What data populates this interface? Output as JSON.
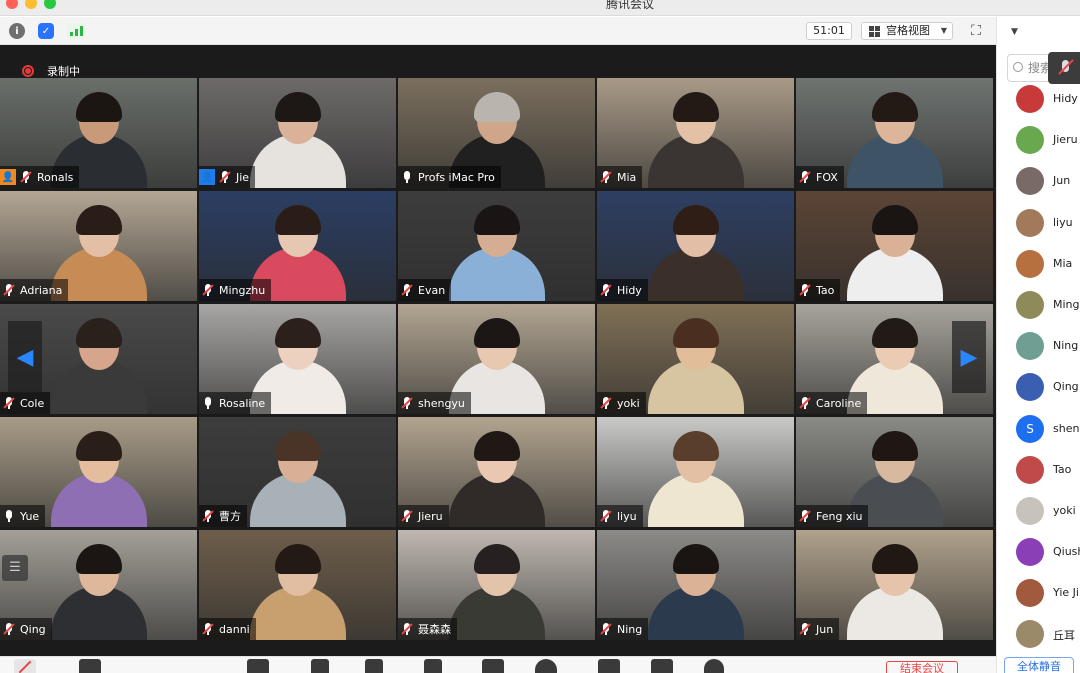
{
  "window": {
    "title": "腾讯会议"
  },
  "toolbar": {
    "timer": "51:01",
    "view_label": "宫格视图"
  },
  "recording": {
    "label": "录制中"
  },
  "tiles": [
    {
      "name": "Ronals",
      "muted": true,
      "badge": "orange",
      "bg": "#6a6f6a",
      "skin": "#c99a7a",
      "hair": "#1c1612",
      "shirt": "#2a2d31"
    },
    {
      "name": "Jie",
      "muted": true,
      "badge": "blue",
      "bg": "#6e6a6a",
      "skin": "#d9b299",
      "hair": "#1d1715",
      "shirt": "#e6e2dd"
    },
    {
      "name": "Profs iMac Pro",
      "muted": false,
      "active": true,
      "bg": "#7b6f5e",
      "skin": "#cfa68a",
      "hair": "#b9b5ae",
      "shirt": "#202020"
    },
    {
      "name": "Mia",
      "muted": true,
      "bg": "#a99a87",
      "skin": "#e2c1a7",
      "hair": "#231a16",
      "shirt": "#3a3432"
    },
    {
      "name": "FOX",
      "muted": true,
      "bg": "#6f7471",
      "skin": "#dcb59b",
      "hair": "#231915",
      "shirt": "#3e5466"
    },
    {
      "name": "Adriana",
      "muted": true,
      "bg": "#b3a694",
      "skin": "#e2bfa5",
      "hair": "#2a1c16",
      "shirt": "#c78b55"
    },
    {
      "name": "Mingzhu",
      "muted": true,
      "bg": "#2b3e63",
      "skin": "#e6c8b2",
      "hair": "#2a1d17",
      "shirt": "#d94a5e"
    },
    {
      "name": "Evan",
      "muted": true,
      "bg": "#3d3d3d",
      "skin": "#d5ad92",
      "hair": "#1a1514",
      "shirt": "#8ab0d8"
    },
    {
      "name": "Hidy",
      "muted": true,
      "bg": "#2e3f63",
      "skin": "#e1bea5",
      "hair": "#2e1e16",
      "shirt": "#3b2f2a"
    },
    {
      "name": "Tao",
      "muted": true,
      "bg": "#5c4536",
      "skin": "#d8b196",
      "hair": "#1a1412",
      "shirt": "#eeeeee"
    },
    {
      "name": "Cole",
      "muted": true,
      "bg": "#4a4a4a",
      "skin": "#d7a58c",
      "hair": "#2a201c",
      "shirt": "#3a3a3a"
    },
    {
      "name": "Rosaline",
      "muted": false,
      "bg": "#a8a6a4",
      "skin": "#edd1c0",
      "hair": "#2b201c",
      "shirt": "#f0ebe6"
    },
    {
      "name": "shengyu",
      "muted": true,
      "bg": "#b2a592",
      "skin": "#e8c8b1",
      "hair": "#1c1614",
      "shirt": "#e9e5e3"
    },
    {
      "name": "yoki",
      "muted": true,
      "bg": "#807056",
      "skin": "#e2bd9a",
      "hair": "#4a2f20",
      "shirt": "#d7c4a0"
    },
    {
      "name": "Caroline",
      "muted": true,
      "bg": "#a8a49c",
      "skin": "#ebcbb4",
      "hair": "#221a16",
      "shirt": "#efe7da"
    },
    {
      "name": "Yue",
      "muted": false,
      "bg": "#a89c88",
      "skin": "#e4bd9e",
      "hair": "#2a1e18",
      "shirt": "#8e6fb3"
    },
    {
      "name": "曹方",
      "muted": true,
      "bg": "#3d3d3d",
      "skin": "#d9b096",
      "hair": "#4a3428",
      "shirt": "#a8b0b8"
    },
    {
      "name": "Jieru",
      "muted": true,
      "bg": "#b2a48f",
      "skin": "#e9c7b1",
      "hair": "#201815",
      "shirt": "#302a28"
    },
    {
      "name": "liyu",
      "muted": true,
      "bg": "#c9c9c7",
      "skin": "#e3c0a3",
      "hair": "#5a3e2c",
      "shirt": "#efe6d2"
    },
    {
      "name": "Feng xiu",
      "muted": true,
      "bg": "#8a8a86",
      "skin": "#d8b89e",
      "hair": "#1f1714",
      "shirt": "#4a4d52"
    },
    {
      "name": "Qing",
      "muted": true,
      "bg": "#a4a098",
      "skin": "#dfb79b",
      "hair": "#1b1513",
      "shirt": "#2d2f33"
    },
    {
      "name": "danni",
      "muted": true,
      "bg": "#6e5e4b",
      "skin": "#e1bda2",
      "hair": "#241a15",
      "shirt": "#c8a070"
    },
    {
      "name": "聂森森",
      "muted": true,
      "bg": "#bfb8b0",
      "skin": "#e3c3aa",
      "hair": "#262020",
      "shirt": "#3a3a34"
    },
    {
      "name": "Ning",
      "muted": true,
      "bg": "#8b8a87",
      "skin": "#dab397",
      "hair": "#1a1513",
      "shirt": "#2c3a4e"
    },
    {
      "name": "Jun",
      "muted": true,
      "bg": "#b0a28c",
      "skin": "#e6c4ab",
      "hair": "#211814",
      "shirt": "#ece9e5"
    }
  ],
  "panel": {
    "search_placeholder": "搜索",
    "participants": [
      {
        "name": "Hidy",
        "avatar_color": "#c83a3a",
        "initial": ""
      },
      {
        "name": "Jieru",
        "avatar_color": "#6aa84f",
        "initial": ""
      },
      {
        "name": "Jun",
        "avatar_color": "#7a6a66",
        "initial": ""
      },
      {
        "name": "liyu",
        "avatar_color": "#a07a5a",
        "initial": ""
      },
      {
        "name": "Mia",
        "avatar_color": "#b6703f",
        "initial": ""
      },
      {
        "name": "Mingz",
        "avatar_color": "#8e8a5a",
        "initial": ""
      },
      {
        "name": "Ning",
        "avatar_color": "#6f9f92",
        "initial": ""
      },
      {
        "name": "Qing",
        "avatar_color": "#3a5fb0",
        "initial": ""
      },
      {
        "name": "sheng",
        "avatar_color": "#1e6ff0",
        "initial": "S"
      },
      {
        "name": "Tao",
        "avatar_color": "#c04a4a",
        "initial": ""
      },
      {
        "name": "yoki",
        "avatar_color": "#c7c2bb",
        "initial": ""
      },
      {
        "name": "Qiush",
        "avatar_color": "#8a3fb6",
        "initial": ""
      },
      {
        "name": "Yie Ji",
        "avatar_color": "#a25a3f",
        "initial": ""
      },
      {
        "name": "丘耳",
        "avatar_color": "#9a8a6a",
        "initial": ""
      }
    ],
    "mute_all_label": "全体静音"
  },
  "bottombar": {
    "end_label": "结束会议"
  }
}
